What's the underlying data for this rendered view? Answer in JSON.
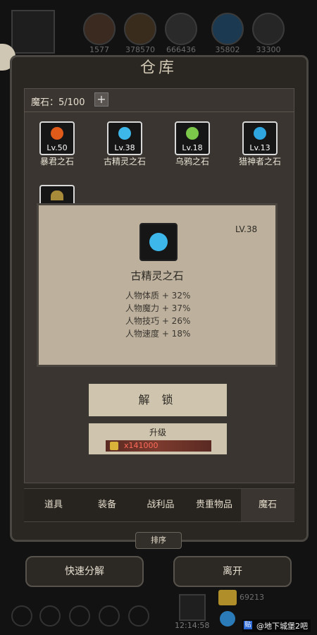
{
  "top_bar": {
    "resources": [
      {
        "icon": "leather-icon",
        "value": "1577",
        "color": "#a04a1e"
      },
      {
        "icon": "wood-icon",
        "value": "378570",
        "color": "#8a5a2a"
      },
      {
        "icon": "ore-icon",
        "value": "666436",
        "color": "#5b5b5b"
      },
      {
        "icon": "crystal-icon",
        "value": "35802",
        "color": "#2f8fc8"
      },
      {
        "icon": "cloth-icon",
        "value": "33300",
        "color": "#666"
      }
    ]
  },
  "window": {
    "title": "仓库"
  },
  "inventory": {
    "label": "魔石：5/100",
    "plus": "+"
  },
  "stones": [
    {
      "level": "Lv.50",
      "name": "暴君之石",
      "color": "#e05a1a"
    },
    {
      "level": "Lv.38",
      "name": "古精灵之石",
      "color": "#3db7ea"
    },
    {
      "level": "Lv.18",
      "name": "乌鸦之石",
      "color": "#7cc84a"
    },
    {
      "level": "Lv.13",
      "name": "猎神者之石",
      "color": "#2fa6e0"
    }
  ],
  "popup": {
    "level": "LV.38",
    "name": "古精灵之石",
    "stats": [
      "人物体质 + 32%",
      "人物魔力 + 37%",
      "人物技巧 + 26%",
      "人物速度 + 18%"
    ],
    "unlock_label": "解 锁",
    "upgrade_label": "升级",
    "upgrade_cost": "x141000",
    "accent": "#3db7ea"
  },
  "tabs": [
    {
      "label": "道具"
    },
    {
      "label": "装备"
    },
    {
      "label": "战利品"
    },
    {
      "label": "贵重物品"
    },
    {
      "label": "魔石",
      "active": true
    }
  ],
  "sort_label": "排序",
  "actions": {
    "salvage": "快速分解",
    "leave": "离开"
  },
  "bottom_bar": {
    "time": "12:14:58",
    "gold": "69213",
    "watermark": "@地下城堡2吧",
    "watermark_icon": "贴"
  }
}
